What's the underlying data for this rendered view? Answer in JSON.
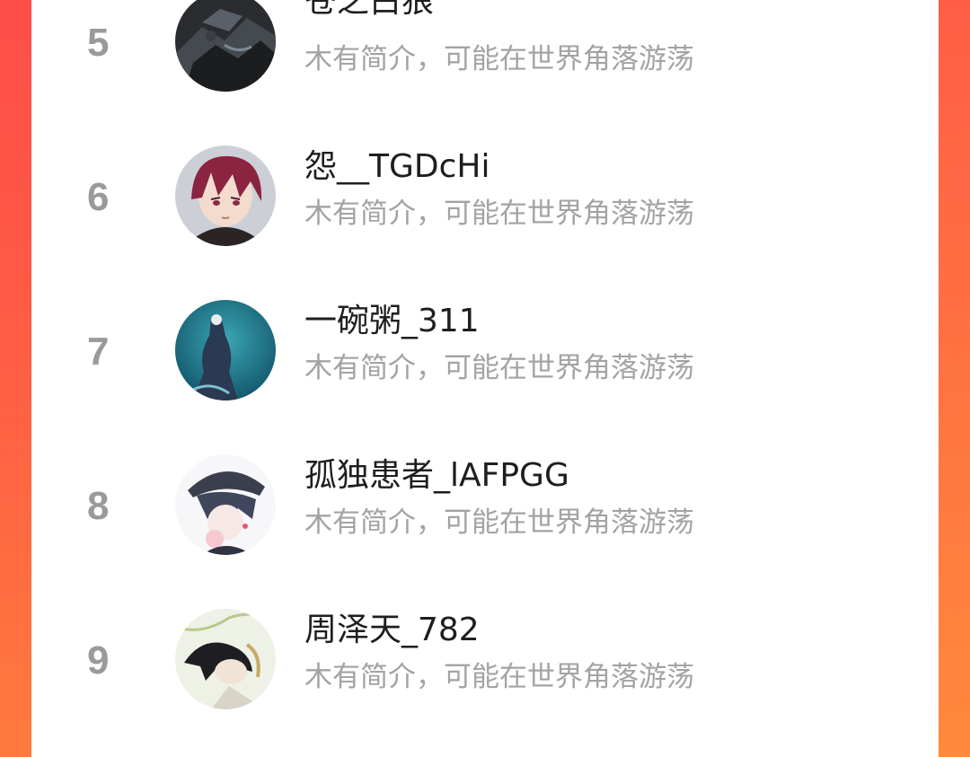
{
  "ranking": {
    "items": [
      {
        "rank": "5",
        "name": "苍之白狼",
        "bio": "木有简介，可能在世界角落游荡",
        "avatar": "dark-wolf-avatar"
      },
      {
        "rank": "6",
        "name": "怨__TGDcHi",
        "bio": "木有简介，可能在世界角落游荡",
        "avatar": "anime-boy-red-hair-avatar"
      },
      {
        "rank": "7",
        "name": "一碗粥_311",
        "bio": "木有简介，可能在世界角落游荡",
        "avatar": "teal-figure-avatar"
      },
      {
        "rank": "8",
        "name": "孤独患者_lAFPGG",
        "bio": "木有简介，可能在世界角落游荡",
        "avatar": "anime-boy-hat-avatar"
      },
      {
        "rank": "9",
        "name": "周泽天_782",
        "bio": "木有简介，可能在世界角落游荡",
        "avatar": "anime-boy-sleeping-avatar"
      }
    ]
  },
  "colors": {
    "accent_left": "#ff4d4a",
    "accent_right": "#ff8a3b",
    "rank_number": "#9a9a9a",
    "name_text": "#1e1e1e",
    "bio_text": "#a3a3a3"
  }
}
